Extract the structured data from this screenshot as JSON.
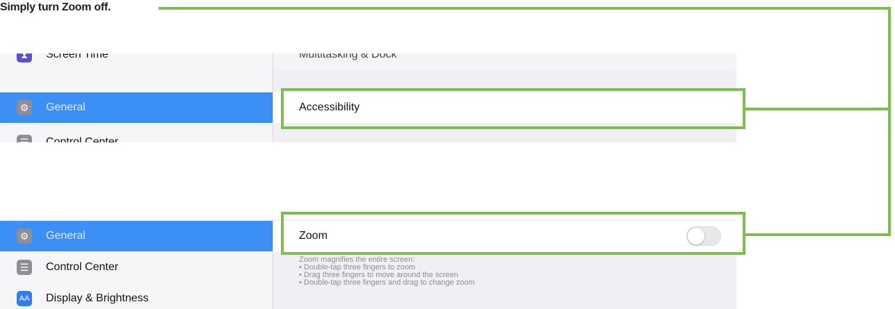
{
  "caption": "Simply turn Zoom off.",
  "colors": {
    "callout": "#7dbf4e",
    "selected": "#3b8ff5",
    "background": "#efeff4"
  },
  "top_panel": {
    "sidebar": [
      {
        "label": "Screen Time",
        "icon": "hourglass-icon",
        "selected": false
      },
      {
        "label": "General",
        "icon": "gear-icon",
        "selected": true
      },
      {
        "label": "Control Center",
        "icon": "toggles-icon",
        "selected": false
      }
    ],
    "content_rows": [
      {
        "label": "Multitasking & Dock"
      },
      {
        "label": "Accessibility"
      }
    ]
  },
  "bottom_panel": {
    "sidebar": [
      {
        "label": "General",
        "icon": "gear-icon",
        "selected": true
      },
      {
        "label": "Control Center",
        "icon": "toggles-icon",
        "selected": false
      },
      {
        "label": "Display & Brightness",
        "icon": "text-size-icon",
        "icon_text": "AA",
        "selected": false
      }
    ],
    "zoom": {
      "label": "Zoom",
      "toggle_on": false
    },
    "zoom_description": [
      "Zoom magnifies the entire screen:",
      "• Double-tap three fingers to zoom",
      "• Drag three fingers to move around the screen",
      "• Double-tap three fingers and drag to change zoom"
    ]
  }
}
